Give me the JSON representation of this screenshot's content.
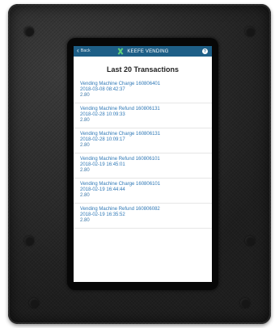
{
  "app": {
    "title": "KEEFE VENDING",
    "back_label": "Back",
    "help_label": "?"
  },
  "page": {
    "heading": "Last 20 Transactions"
  },
  "transactions": [
    {
      "description": "Vending Machine Charge 160806401",
      "timestamp": "2018-03-08 08:42:37",
      "amount": "2.80"
    },
    {
      "description": "Vending Machine Refund 160806131",
      "timestamp": "2018-02-28 10:09:33",
      "amount": "2.80"
    },
    {
      "description": "Vending Machine Charge 160806131",
      "timestamp": "2018-02-28 10:09:17",
      "amount": "2.80"
    },
    {
      "description": "Vending Machine Refund 160806101",
      "timestamp": "2018-02-19 16:45:01",
      "amount": "2.80"
    },
    {
      "description": "Vending Machine Charge 160806101",
      "timestamp": "2018-02-19 16:44:44",
      "amount": "2.80"
    },
    {
      "description": "Vending Machine Refund 160806082",
      "timestamp": "2018-02-19 16:35:52",
      "amount": "2.80"
    }
  ],
  "colors": {
    "header_bg": "#1e5f87",
    "link_text": "#2f78b6",
    "logo_green": "#5fd07b"
  }
}
